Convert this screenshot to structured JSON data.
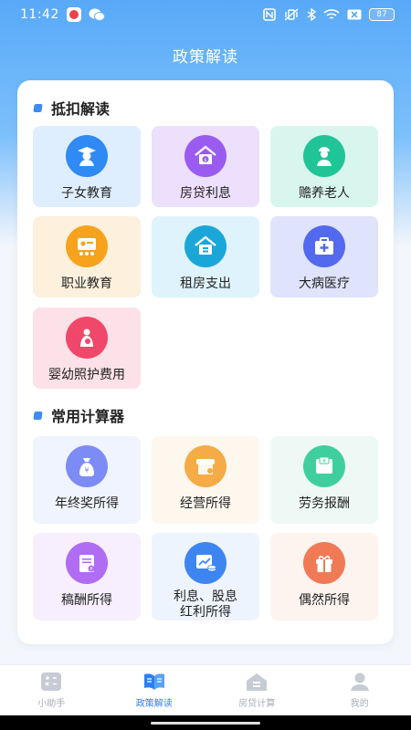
{
  "status_bar": {
    "time": "11:42",
    "battery": "87"
  },
  "header": {
    "title": "政策解读"
  },
  "deduction_section": {
    "title": "抵扣解读",
    "items": [
      {
        "label": "子女教育",
        "icon": "graduate-icon",
        "bg": "#deeefe",
        "icon_color": "#2f8af3"
      },
      {
        "label": "房贷利息",
        "icon": "house-loan-icon",
        "bg": "#ece0fd",
        "icon_color": "#9a5cf0"
      },
      {
        "label": "赡养老人",
        "icon": "elderly-icon",
        "bg": "#d9f6ee",
        "icon_color": "#21c497"
      },
      {
        "label": "职业教育",
        "icon": "classroom-icon",
        "bg": "#fdf0dc",
        "icon_color": "#f6a21b"
      },
      {
        "label": "租房支出",
        "icon": "rent-house-icon",
        "bg": "#dff3fc",
        "icon_color": "#1ba6d9"
      },
      {
        "label": "大病医疗",
        "icon": "medical-kit-icon",
        "bg": "#dfe3fb",
        "icon_color": "#5369ee"
      },
      {
        "label": "婴幼照护费用",
        "icon": "infant-care-icon",
        "bg": "#fde1e8",
        "icon_color": "#f0486a"
      }
    ]
  },
  "calculator_section": {
    "title": "常用计算器",
    "items": [
      {
        "label": "年终奖所得",
        "icon": "money-bag-icon",
        "bg": "#f0f4fe",
        "icon_color": "#7d8cf4"
      },
      {
        "label": "经营所得",
        "icon": "shop-icon",
        "bg": "#fdf7ee",
        "icon_color": "#f5ab46"
      },
      {
        "label": "劳务报酬",
        "icon": "wallet-icon",
        "bg": "#eef9f6",
        "icon_color": "#3fcf9f"
      },
      {
        "label": "稿酬所得",
        "icon": "manuscript-icon",
        "bg": "#f7effd",
        "icon_color": "#b06cf2"
      },
      {
        "label": "利息、股息\n红利所得",
        "icon": "dividend-chart-icon",
        "bg": "#eef4fe",
        "icon_color": "#3d86f2"
      },
      {
        "label": "偶然所得",
        "icon": "gift-icon",
        "bg": "#fdf3ef",
        "icon_color": "#f07a55"
      }
    ]
  },
  "tab_bar": {
    "tabs": [
      {
        "label": "小助手",
        "icon": "calculator-icon"
      },
      {
        "label": "政策解读",
        "icon": "book-icon"
      },
      {
        "label": "房贷计算",
        "icon": "house-icon"
      },
      {
        "label": "我的",
        "icon": "person-icon"
      }
    ],
    "active_index": 1
  }
}
